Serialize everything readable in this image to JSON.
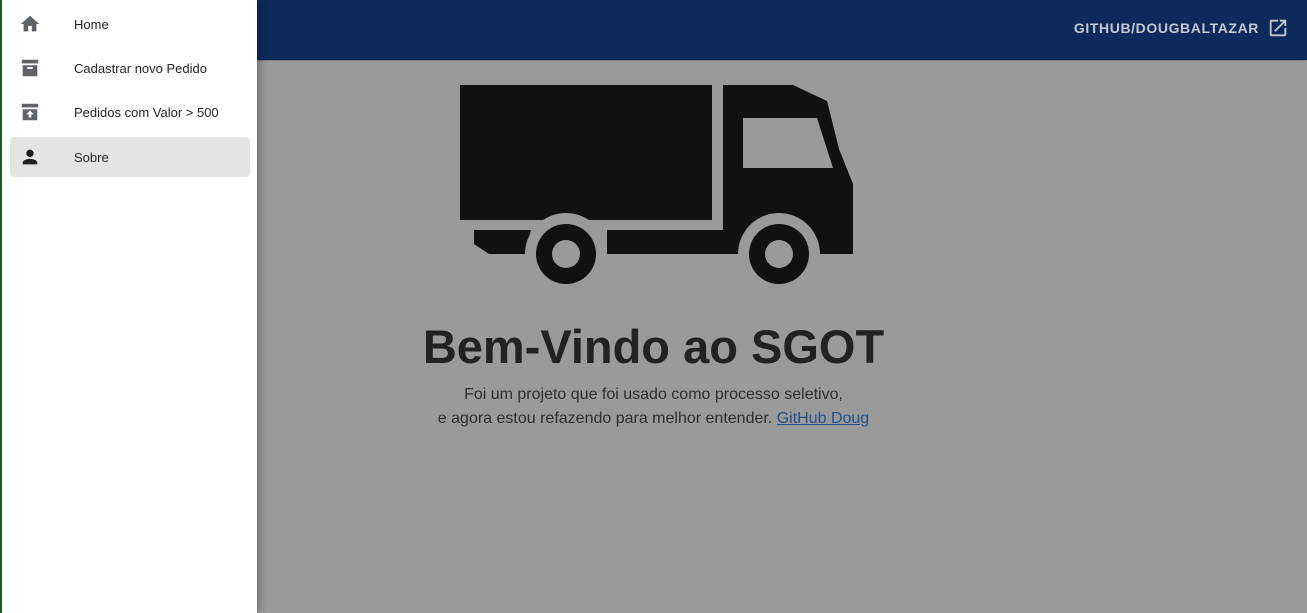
{
  "drawer": {
    "items": [
      {
        "label": "Home",
        "icon": "home-icon",
        "active": false
      },
      {
        "label": "Cadastrar novo Pedido",
        "icon": "archive-icon",
        "active": false
      },
      {
        "label": "Pedidos com Valor > 500",
        "icon": "unarchive-icon",
        "active": false
      },
      {
        "label": "Sobre",
        "icon": "person-icon",
        "active": true
      }
    ]
  },
  "appbar": {
    "github_label": "GITHUB/DOUGBALTAZAR",
    "github_icon": "open-in-new-icon",
    "color": "#0e2a5c"
  },
  "hero": {
    "illustration": "truck-icon",
    "title": "Bem-Vindo ao SGOT",
    "line1": "Foi um projeto que foi usado como processo seletivo,",
    "line2": "e agora estou refazendo para melhor entender.",
    "link_text": "GitHub Doug",
    "link_color": "#22508c"
  },
  "colors": {
    "scrim_background": "#9a9a9a",
    "drawer_active": "#e4e4e4"
  }
}
